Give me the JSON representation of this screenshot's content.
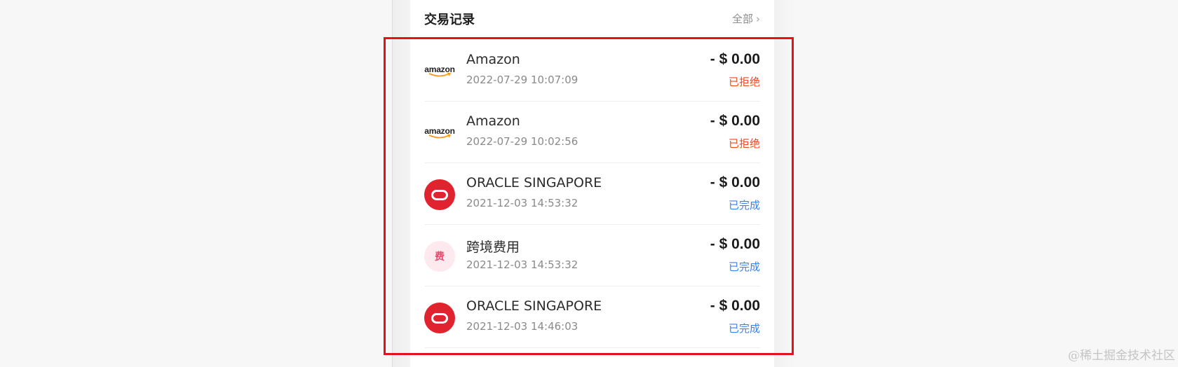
{
  "section": {
    "title": "交易记录",
    "view_all_label": "全部",
    "view_all_icon": "chevron-right-icon"
  },
  "transactions": [
    {
      "merchant": "Amazon",
      "logo": "amazon-logo",
      "logo_text": "amazon",
      "time": "2022-07-29 10:07:09",
      "amount": "- $ 0.00",
      "status": "已拒绝",
      "status_type": "rejected"
    },
    {
      "merchant": "Amazon",
      "logo": "amazon-logo",
      "logo_text": "amazon",
      "time": "2022-07-29 10:02:56",
      "amount": "- $ 0.00",
      "status": "已拒绝",
      "status_type": "rejected"
    },
    {
      "merchant": "ORACLE SINGAPORE",
      "logo": "oracle-logo",
      "time": "2021-12-03 14:53:32",
      "amount": "- $ 0.00",
      "status": "已完成",
      "status_type": "completed"
    },
    {
      "merchant": "跨境费用",
      "logo": "fee-logo",
      "logo_text": "费",
      "time": "2021-12-03 14:53:32",
      "amount": "- $ 0.00",
      "status": "已完成",
      "status_type": "completed"
    },
    {
      "merchant": "ORACLE SINGAPORE",
      "logo": "oracle-logo",
      "time": "2021-12-03 14:46:03",
      "amount": "- $ 0.00",
      "status": "已完成",
      "status_type": "completed"
    }
  ],
  "colors": {
    "rejected": "#e8491d",
    "completed": "#3d7ee8",
    "oracle_red": "#e0232e",
    "highlight": "#e3121b"
  },
  "watermark": "@稀土掘金技术社区"
}
